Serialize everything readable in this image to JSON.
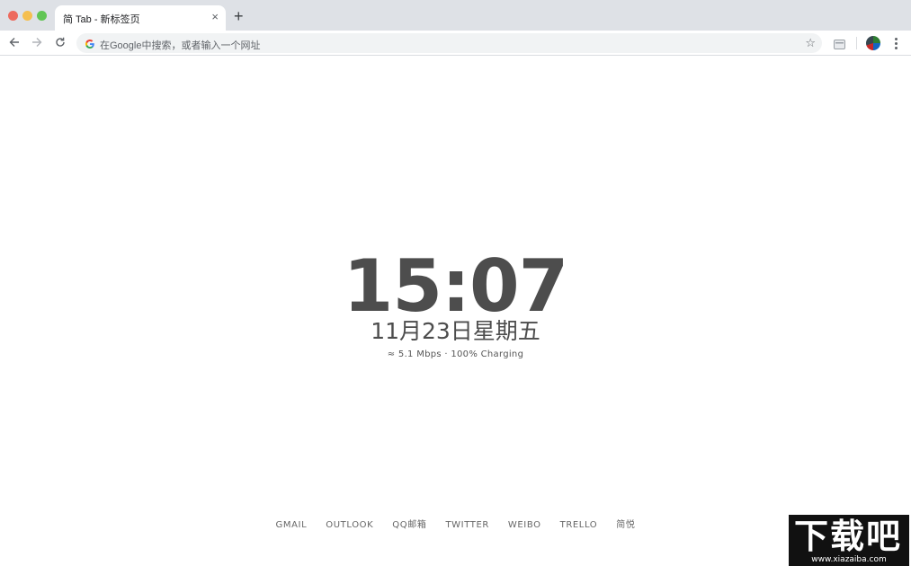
{
  "browser": {
    "tab": {
      "title": "简 Tab - 新标签页",
      "close_glyph": "×"
    },
    "new_tab_glyph": "+",
    "omnibox": {
      "placeholder": "在Google中搜索，或者输入一个网址"
    },
    "icons": [
      "back-arrow-icon",
      "forward-arrow-icon",
      "reload-icon",
      "google-g-icon",
      "star-icon",
      "extension-icon",
      "avatar",
      "more-menu-icon"
    ]
  },
  "newtab": {
    "time": "15:07",
    "date": "11月23日星期五",
    "status": "≈ 5.1 Mbps · 100% Charging"
  },
  "links": [
    {
      "label": "GMAIL"
    },
    {
      "label": "OUTLOOK"
    },
    {
      "label": "QQ邮箱"
    },
    {
      "label": "TWITTER"
    },
    {
      "label": "WEIBO"
    },
    {
      "label": "TRELLO"
    },
    {
      "label": "简悦"
    }
  ],
  "watermark": {
    "brand": "下载吧",
    "url": "www.xiazaiba.com"
  },
  "colors": {
    "tabstrip": "#dee1e6",
    "clock": "#4d4d4d",
    "link": "#666666"
  }
}
